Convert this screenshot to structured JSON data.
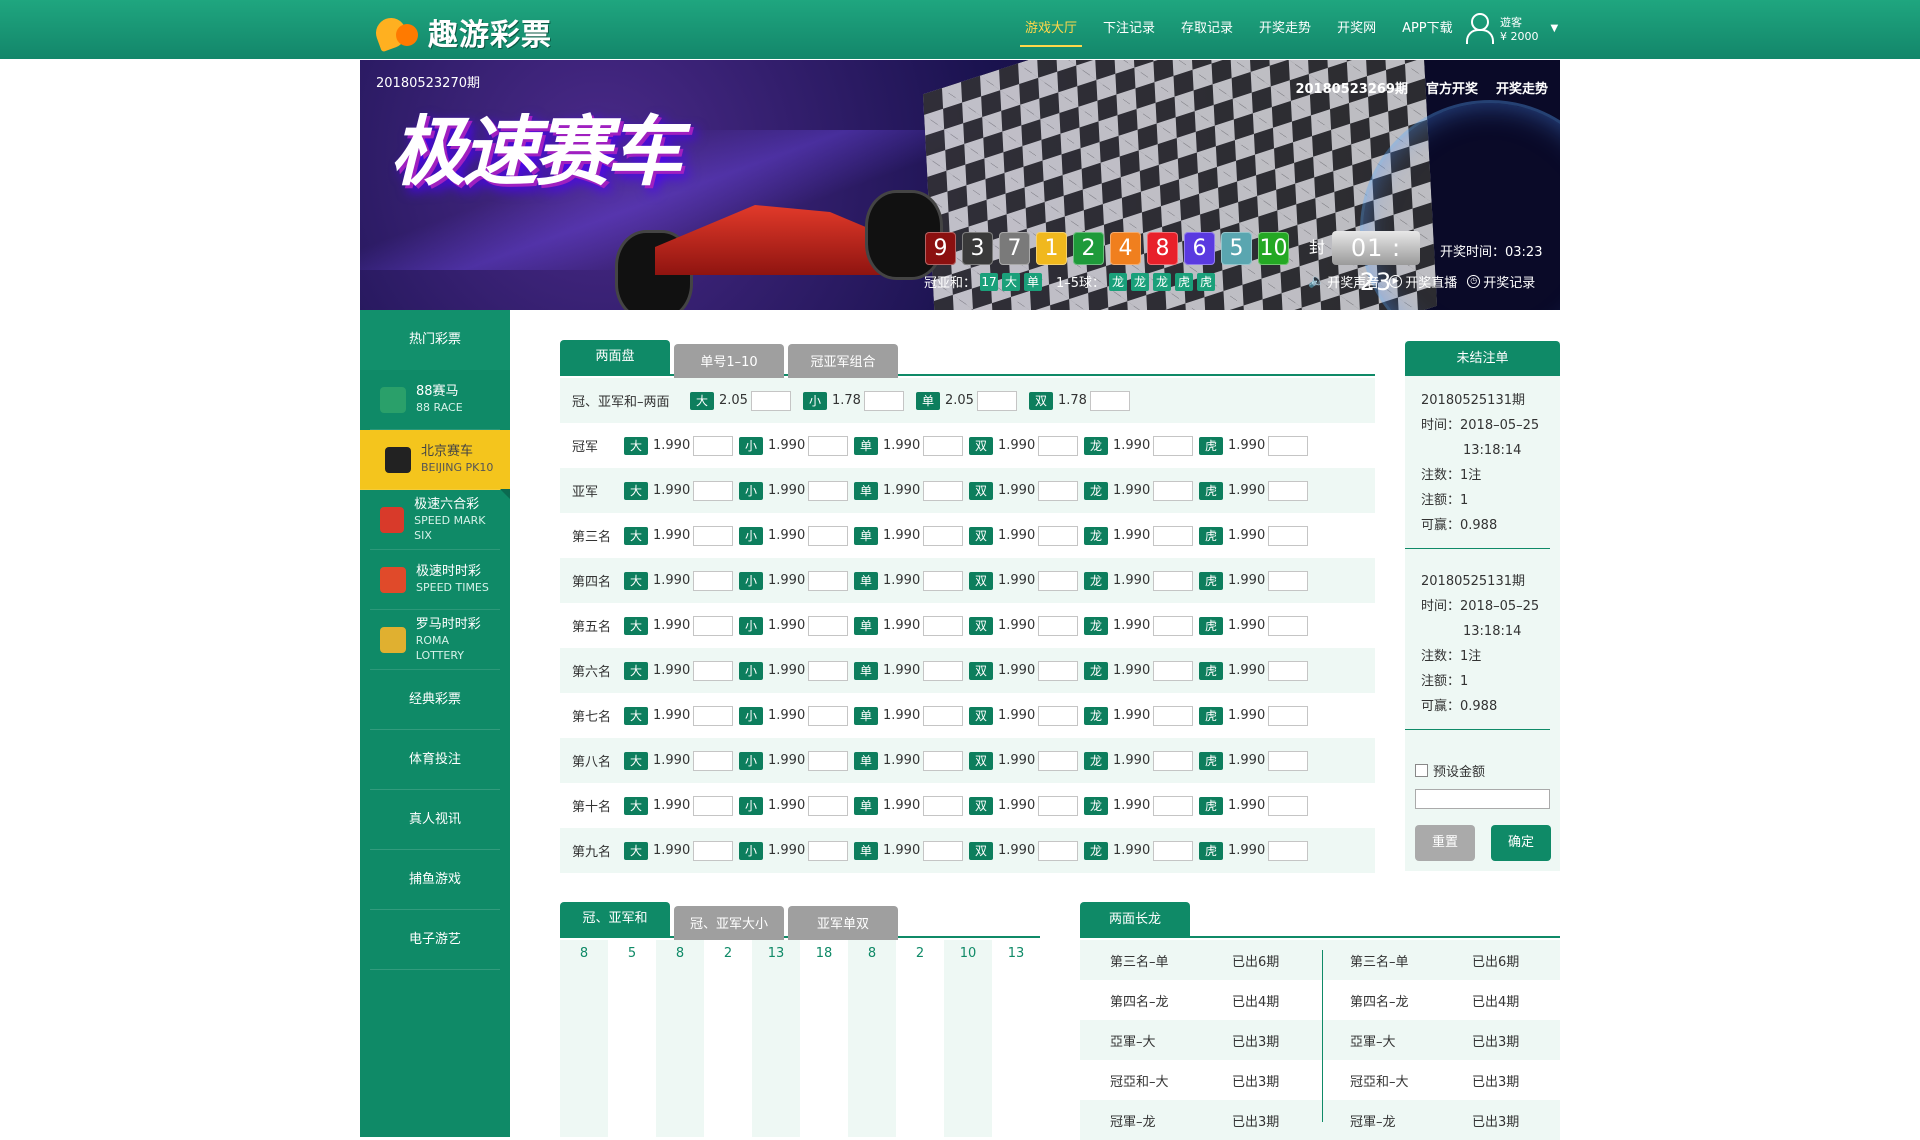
{
  "header": {
    "logo_text": "趣游彩票",
    "nav": [
      "游戏大厅",
      "下注记录",
      "存取记录",
      "开奖走势",
      "开奖网",
      "APP下载"
    ],
    "active_nav": 0,
    "user": {
      "name": "遊客",
      "balance": "¥ 2000"
    }
  },
  "banner": {
    "title": "极速赛车",
    "current_issue": "20180523270期",
    "last_issue": "20180523269期",
    "links": [
      "官方开奖",
      "开奖走势"
    ],
    "balls": [
      {
        "n": "9",
        "color": "#8b1010"
      },
      {
        "n": "3",
        "color": "#3a3a3a"
      },
      {
        "n": "7",
        "color": "#7a7a7a"
      },
      {
        "n": "1",
        "color": "#f0b81e"
      },
      {
        "n": "2",
        "color": "#1e9a3a"
      },
      {
        "n": "4",
        "color": "#f07f1e"
      },
      {
        "n": "8",
        "color": "#e8202a"
      },
      {
        "n": "6",
        "color": "#5a3ae0"
      },
      {
        "n": "5",
        "color": "#5aa6b0"
      },
      {
        "n": "10",
        "color": "#24a824"
      }
    ],
    "seal_label": "封",
    "timer": "01 : 23",
    "draw_time": "开奖时间：03:23",
    "sum_label": "冠亚和：",
    "sum_tags": [
      "17",
      "大",
      "单"
    ],
    "range_label": "1–5球：",
    "range_tags": [
      "龙",
      "龙",
      "龙",
      "虎",
      "虎"
    ],
    "tools": [
      "开奖声音",
      "开奖直播",
      "开奖记录"
    ]
  },
  "sidebar": {
    "hot_title": "热门彩票",
    "games": [
      {
        "name": "88赛马",
        "en": "88 RACE",
        "icon_color": "#2aa06a"
      },
      {
        "name": "北京赛车",
        "en": "BEIJING PK10",
        "icon_color": "#222"
      },
      {
        "name": "极速六合彩",
        "en": "SPEED MARK SIX",
        "icon_color": "#d83a2a"
      },
      {
        "name": "极速时时彩",
        "en": "SPEED TIMES",
        "icon_color": "#e04a2a"
      },
      {
        "name": "罗马时时彩",
        "en": "ROMA LOTTERY",
        "icon_color": "#e0b030"
      }
    ],
    "active_game": 1,
    "categories": [
      "经典彩票",
      "体育投注",
      "真人视讯",
      "捕鱼游戏",
      "电子游艺"
    ]
  },
  "main": {
    "tabs": [
      "两面盘",
      "单号1–10",
      "冠亚军组合"
    ],
    "first_row": {
      "label": "冠、亚军和–两面",
      "items": [
        {
          "tag": "大",
          "odds": "2.05"
        },
        {
          "tag": "小",
          "odds": "1.78"
        },
        {
          "tag": "单",
          "odds": "2.05"
        },
        {
          "tag": "双",
          "odds": "1.78"
        }
      ]
    },
    "row_tags": [
      "大",
      "小",
      "单",
      "双",
      "龙",
      "虎"
    ],
    "row_odds": "1.990",
    "rows": [
      "冠军",
      "亚军",
      "第三名",
      "第四名",
      "第五名",
      "第六名",
      "第七名",
      "第八名",
      "第十名",
      "第九名"
    ]
  },
  "side_panel": {
    "title": "未结注单",
    "orders": [
      {
        "issue": "20180525131期",
        "time_label": "时间：",
        "date": "2018–05–25",
        "time": "13:18:14",
        "count": "注数：1注",
        "amount": "注额：1",
        "win": "可赢：0.988"
      },
      {
        "issue": "20180525131期",
        "time_label": "时间：",
        "date": "2018–05–25",
        "time": "13:18:14",
        "count": "注数：1注",
        "amount": "注额：1",
        "win": "可赢：0.988"
      }
    ],
    "preset_label": "预设金额",
    "reset": "重置",
    "confirm": "确定"
  },
  "bottom": {
    "tabs": [
      "冠、亚军和",
      "冠、亚军大小",
      "亚军单双"
    ],
    "values": [
      "8",
      "5",
      "8",
      "2",
      "13",
      "18",
      "8",
      "2",
      "10",
      "13"
    ],
    "long_tab": "两面长龙",
    "long_rows": [
      {
        "a": "第三名–单",
        "b": "已出6期",
        "c": "第三名–单",
        "d": "已出6期"
      },
      {
        "a": "第四名–龙",
        "b": "已出4期",
        "c": "第四名–龙",
        "d": "已出4期"
      },
      {
        "a": "亞軍–大",
        "b": "已出3期",
        "c": "亞軍–大",
        "d": "已出3期"
      },
      {
        "a": "冠亞和–大",
        "b": "已出3期",
        "c": "冠亞和–大",
        "d": "已出3期"
      },
      {
        "a": "冠軍–龙",
        "b": "已出3期",
        "c": "冠軍–龙",
        "d": "已出3期"
      }
    ]
  }
}
